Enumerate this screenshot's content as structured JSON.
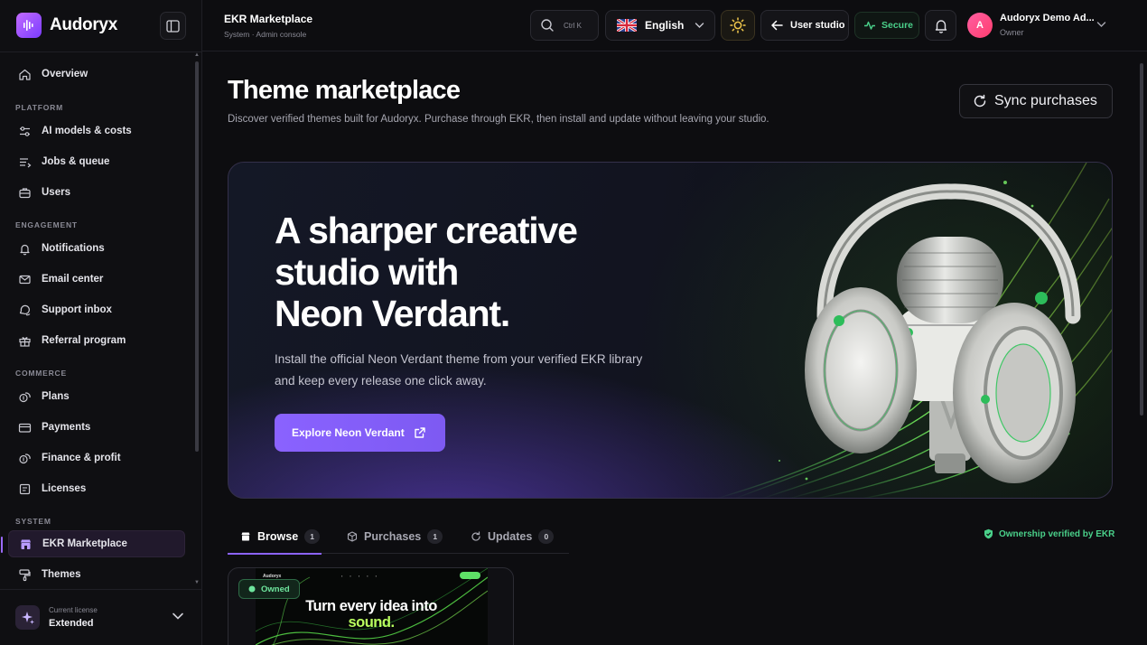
{
  "brand": {
    "name": "Audoryx"
  },
  "sidebar": {
    "overview": "Overview",
    "sections": [
      {
        "label": "PLATFORM",
        "items": [
          "AI models & costs",
          "Jobs & queue",
          "Users"
        ]
      },
      {
        "label": "ENGAGEMENT",
        "items": [
          "Notifications",
          "Email center",
          "Support inbox",
          "Referral program"
        ]
      },
      {
        "label": "COMMERCE",
        "items": [
          "Plans",
          "Payments",
          "Finance & profit",
          "Licenses"
        ]
      },
      {
        "label": "SYSTEM",
        "items": [
          "EKR Marketplace",
          "Themes"
        ]
      }
    ],
    "active_item": "EKR Marketplace",
    "license": {
      "caption": "Current license",
      "value": "Extended"
    }
  },
  "topbar": {
    "title": "EKR Marketplace",
    "subtitle": "System · Admin console",
    "search_shortcut": "Ctrl K",
    "language": "English",
    "user_studio": "User studio",
    "secure": "Secure",
    "user": {
      "initial": "A",
      "name": "Audoryx Demo Ad...",
      "role": "Owner"
    }
  },
  "main": {
    "title": "Theme marketplace",
    "description": "Discover verified themes built for Audoryx. Purchase through EKR, then install and update without leaving your studio.",
    "sync_button": "Sync purchases"
  },
  "hero": {
    "title_line1": "A sharper creative",
    "title_line2": "studio with",
    "title_line3": "Neon Verdant.",
    "description": "Install the official Neon Verdant theme from your verified EKR library and keep every release one click away.",
    "cta": "Explore Neon Verdant"
  },
  "tabs": [
    {
      "label": "Browse",
      "count": "1",
      "active": true
    },
    {
      "label": "Purchases",
      "count": "1",
      "active": false
    },
    {
      "label": "Updates",
      "count": "0",
      "active": false
    }
  ],
  "verified_note": "Ownership verified by EKR",
  "theme_card": {
    "badge": "Owned",
    "preview_brand": "Audoryx",
    "preview_headline_1": "Turn every idea into",
    "preview_headline_2": "sound."
  },
  "colors": {
    "accent": "#8b63ff",
    "secure_green": "#4ad08a",
    "background": "#0d0d10"
  }
}
